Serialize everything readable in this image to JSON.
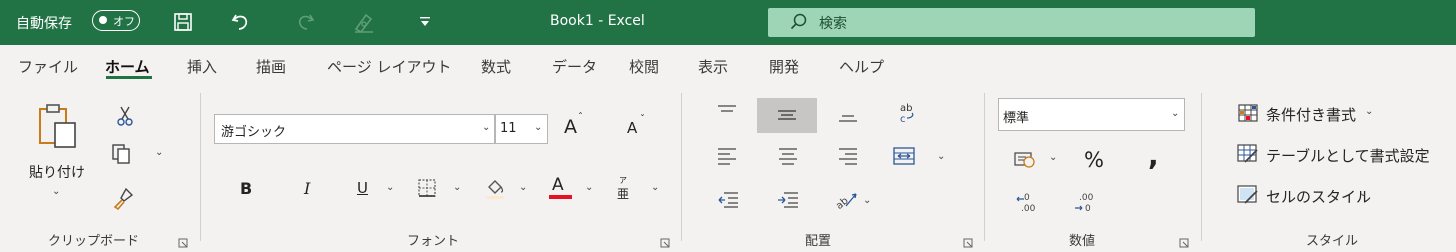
{
  "titlebar": {
    "autosave_label": "自動保存",
    "autosave_state": "オフ",
    "doc_title": "Book1  -  Excel",
    "search_placeholder": "検索",
    "bg_color": "#217346"
  },
  "tabs": [
    {
      "label": "ファイル"
    },
    {
      "label": "ホーム",
      "active": true
    },
    {
      "label": "挿入"
    },
    {
      "label": "描画"
    },
    {
      "label": "ページ レイアウト"
    },
    {
      "label": "数式"
    },
    {
      "label": "データ"
    },
    {
      "label": "校閲"
    },
    {
      "label": "表示"
    },
    {
      "label": "開発"
    },
    {
      "label": "ヘルプ"
    }
  ],
  "clipboard": {
    "paste_label": "貼り付け",
    "group_label": "クリップボード"
  },
  "font": {
    "font_name": "游ゴシック",
    "font_size": "11",
    "bold": "B",
    "italic": "I",
    "underline": "U",
    "increase": "A",
    "decrease": "A",
    "font_color_letter": "A",
    "phonetic": "亜",
    "phonetic_top": "ア",
    "group_label": "フォント",
    "font_color": "#e81123"
  },
  "alignment": {
    "group_label": "配置",
    "wrap_text": "ab"
  },
  "number": {
    "format": "標準",
    "percent": "%",
    "comma": ",",
    "group_label": "数値"
  },
  "styles": {
    "conditional": "条件付き書式",
    "table": "テーブルとして書式設定",
    "cell_styles": "セルのスタイル",
    "group_label": "スタイル"
  }
}
